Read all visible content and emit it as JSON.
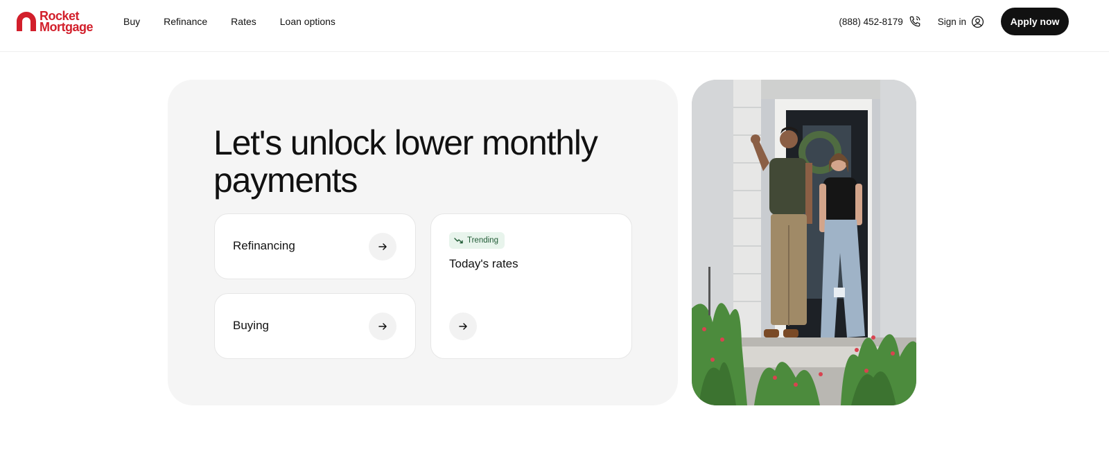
{
  "brand": {
    "name_line1": "Rocket",
    "name_line2": "Mortgage",
    "color": "#d21f2b"
  },
  "nav": {
    "items": [
      {
        "label": "Buy"
      },
      {
        "label": "Refinance"
      },
      {
        "label": "Rates"
      },
      {
        "label": "Loan options"
      }
    ]
  },
  "header": {
    "phone": "(888) 452-8179",
    "phone_icon": "phone-icon",
    "signin_label": "Sign in",
    "signin_icon": "user-circle-icon",
    "apply_label": "Apply now"
  },
  "hero": {
    "title": "Let's unlock lower monthly payments",
    "cards": {
      "refinancing": {
        "label": "Refinancing",
        "icon": "arrow-right-icon"
      },
      "buying": {
        "label": "Buying",
        "icon": "arrow-right-icon"
      },
      "rates": {
        "badge": "Trending",
        "badge_icon": "trending-down-icon",
        "label": "Today's rates",
        "icon": "arrow-right-icon"
      }
    },
    "photo_icon": "couple-at-front-door-photo"
  },
  "colors": {
    "panel_bg": "#f5f5f5",
    "button_dark": "#111111",
    "badge_bg": "#e8f4ec",
    "badge_text": "#1f5a34"
  }
}
